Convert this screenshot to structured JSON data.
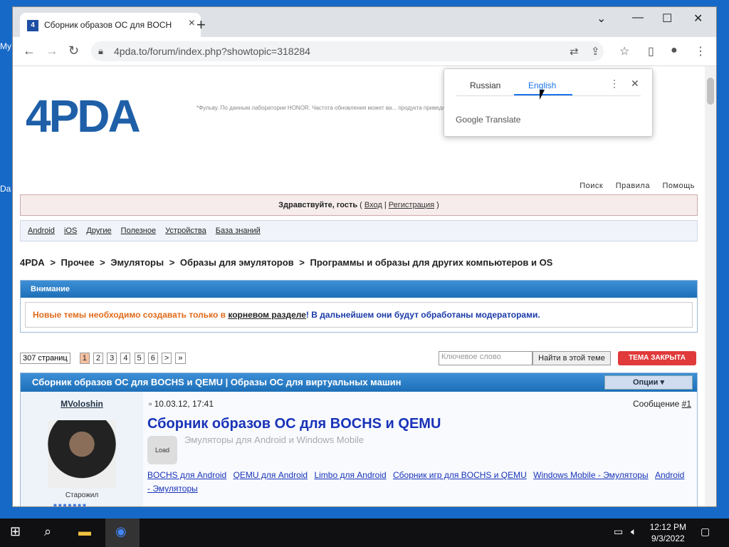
{
  "desktop": {
    "frag1": "My",
    "frag2": "Da"
  },
  "browser": {
    "tab_title": "Сборник образов ОС для BOCH",
    "url": "4pda.to/forum/index.php?showtopic=318284"
  },
  "translate_popup": {
    "lang1": "Russian",
    "lang2": "English",
    "brand": "Google Translate"
  },
  "site": {
    "logo": "4PDA",
    "ad_text": "*Фульву. По данным лаборатории HONOR. Частота обновления может ва... продукта приведены для справки. Фактические характеристики продукта ... 64 Мп.",
    "top_links": [
      "Поиск",
      "Правила",
      "Помощь"
    ],
    "greeting": "Здравствуйте, гость",
    "login": "Вход",
    "register": "Регистрация",
    "categories": [
      "Android",
      "iOS",
      "Другие",
      "Полезное",
      "Устройства",
      "База знаний"
    ],
    "breadcrumbs": [
      "4PDA",
      ">",
      "Прочее",
      ">",
      "Эмуляторы",
      ">",
      "Образы для эмуляторов",
      ">",
      "Программы и образы для других компьютеров и OS"
    ],
    "attention_title": "Внимание",
    "attention_text1": "Новые темы необходимо создавать только в",
    "attention_link": "корневом разделе",
    "attention_text2": "! В дальнейшем они будут обработаны модераторами.",
    "pages_select": "307 страниц",
    "pages": [
      "1",
      "2",
      "3",
      "4",
      "5",
      "6",
      ">",
      "»"
    ],
    "search_placeholder": "Ключевое слово",
    "search_button": "Найти в этой теме",
    "closed_label": "ТЕМА ЗАКРЫТА",
    "topic_header": "Сборник образов ОС для BOCHS и QEMU | Образы ОС для виртуальных машин",
    "options_label": "Опции ▾",
    "author": "MVoloshin",
    "rank": "Старожил",
    "post_date": "10.03.12, 17:41",
    "post_num_label": "Сообщение",
    "post_num": "#1",
    "post_title": "Сборник образов ОС для BOCHS и QEMU",
    "post_sub": "Эмуляторы для Android и Windows Mobile",
    "load_icon_label": "Load",
    "post_links": [
      "BOCHS для Android",
      "QEMU для Android",
      "Limbo для Android",
      "Сборник игр для BOCHS и QEMU",
      "Windows Mobile - Эмуляторы",
      "Android - Эмуляторы"
    ]
  },
  "taskbar": {
    "time": "12:12 PM",
    "date": "9/3/2022"
  }
}
